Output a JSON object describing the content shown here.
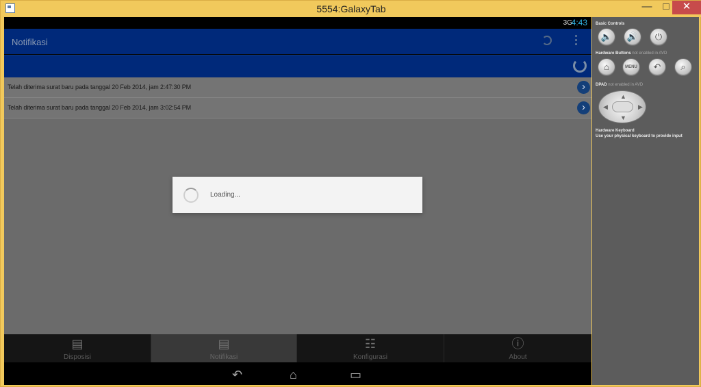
{
  "window": {
    "title": "5554:GalaxyTab",
    "minimize_label": "—",
    "maximize_label": "□",
    "close_label": "✕"
  },
  "status": {
    "network": "3G",
    "time": "4:43"
  },
  "action_bar": {
    "title": "Notifikasi"
  },
  "notifications": [
    {
      "text": "Telah diterima surat baru pada tanggal 20 Feb 2014, jam 2:47:30 PM"
    },
    {
      "text": "Telah diterima surat baru pada tanggal 20 Feb 2014, jam 3:02:54 PM"
    }
  ],
  "dialog": {
    "text": "Loading..."
  },
  "tabs": [
    {
      "label": "Disposisi",
      "icon": "document-edit-icon"
    },
    {
      "label": "Notifikasi",
      "icon": "notification-list-icon",
      "active": true
    },
    {
      "label": "Konfigurasi",
      "icon": "database-settings-icon"
    },
    {
      "label": "About",
      "icon": "info-icon"
    }
  ],
  "side_panel": {
    "basic_controls": "Basic Controls",
    "hardware_buttons": "Hardware Buttons",
    "hardware_buttons_note": "not enabled in AVD",
    "dpad": "DPAD",
    "dpad_note": "not enabled in AVD",
    "hardware_keyboard": "Hardware Keyboard",
    "keyboard_note": "Use your physical keyboard to provide input",
    "menu": "MENU"
  }
}
